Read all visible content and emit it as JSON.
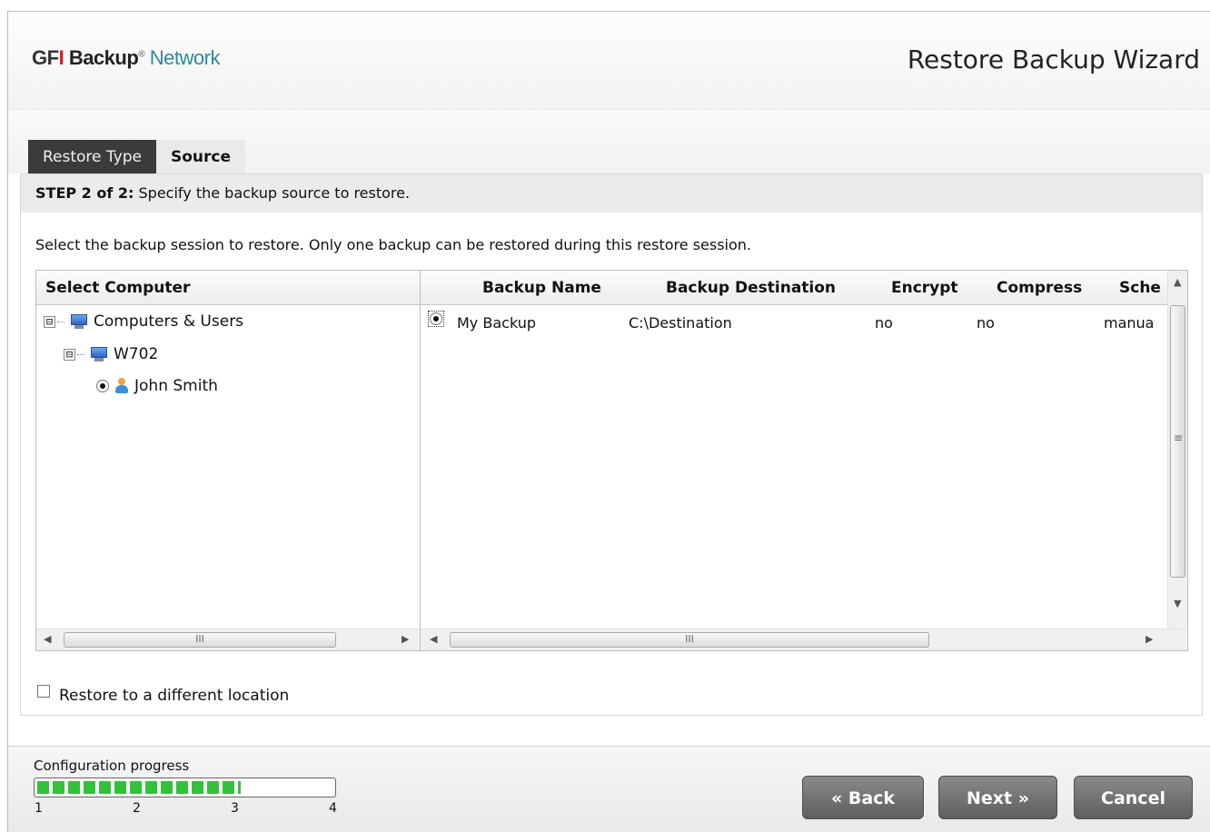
{
  "header": {
    "logo_gfi_g": "GF",
    "logo_gfi_i": "I",
    "logo_backup": "Backup",
    "logo_tm": "®",
    "logo_network": "Network",
    "wizard_title": "Restore Backup Wizard"
  },
  "tabs": [
    {
      "label": "Restore Type",
      "active": false
    },
    {
      "label": "Source",
      "active": true
    }
  ],
  "step": {
    "prefix": "STEP 2 of 2:",
    "text": "Specify the backup source to restore."
  },
  "instruction": "Select the backup session to restore. Only one backup can be restored during this restore session.",
  "computer_tree": {
    "header": "Select Computer",
    "nodes": [
      {
        "label": "Computers & Users",
        "icon": "computer-icon",
        "expander": "⊟"
      },
      {
        "label": "W702",
        "icon": "computer-icon",
        "expander": "⊟"
      },
      {
        "label": "John Smith",
        "icon": "user-icon",
        "selected": true
      }
    ]
  },
  "backup_grid": {
    "columns": [
      "Backup Name",
      "Backup Destination",
      "Encrypt",
      "Compress",
      "Sche"
    ],
    "rows": [
      {
        "name": "My Backup",
        "destination": "C:\\Destination",
        "encrypt": "no",
        "compress": "no",
        "schedule": "manua",
        "selected": true
      }
    ]
  },
  "restore_different_location": {
    "label": "Restore to a different location",
    "checked": false
  },
  "progress": {
    "label": "Configuration progress",
    "ticks": [
      "1",
      "2",
      "3",
      "4"
    ],
    "value_fraction": 0.69
  },
  "buttons": {
    "back": "« Back",
    "next": "Next »",
    "cancel": "Cancel"
  },
  "scroll_glyphs": {
    "left": "◀",
    "right": "▶",
    "up": "▲",
    "down": "▼",
    "grip_h": "III",
    "grip_v": "≡"
  }
}
